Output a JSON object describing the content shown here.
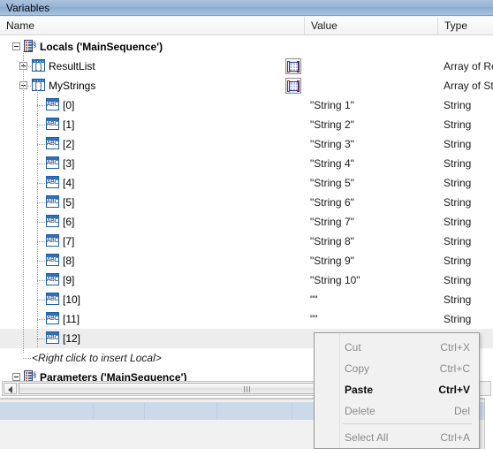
{
  "window": {
    "title": "Variables"
  },
  "columns": {
    "name": "Name",
    "value": "Value",
    "type": "Type"
  },
  "tree": {
    "root": {
      "label": "Locals ('MainSequence')",
      "icon": "locals-icon",
      "expander": "minus"
    },
    "nodes": [
      {
        "label": "ResultList",
        "icon": "array-icon",
        "expander": "plus",
        "value": "",
        "type": "Array of Result",
        "has_array_button": true
      },
      {
        "label": "MyStrings",
        "icon": "array-icon",
        "expander": "minus",
        "value": "",
        "type": "Array of String",
        "has_array_button": true
      },
      {
        "label": "[0]",
        "icon": "string-icon",
        "value": "\"String 1\"",
        "type": "String"
      },
      {
        "label": "[1]",
        "icon": "string-icon",
        "value": "\"String 2\"",
        "type": "String"
      },
      {
        "label": "[2]",
        "icon": "string-icon",
        "value": "\"String 3\"",
        "type": "String"
      },
      {
        "label": "[3]",
        "icon": "string-icon",
        "value": "\"String 4\"",
        "type": "String"
      },
      {
        "label": "[4]",
        "icon": "string-icon",
        "value": "\"String 5\"",
        "type": "String"
      },
      {
        "label": "[5]",
        "icon": "string-icon",
        "value": "\"String 6\"",
        "type": "String"
      },
      {
        "label": "[6]",
        "icon": "string-icon",
        "value": "\"String 7\"",
        "type": "String"
      },
      {
        "label": "[7]",
        "icon": "string-icon",
        "value": "\"String 8\"",
        "type": "String"
      },
      {
        "label": "[8]",
        "icon": "string-icon",
        "value": "\"String 9\"",
        "type": "String"
      },
      {
        "label": "[9]",
        "icon": "string-icon",
        "value": "\"String 10\"",
        "type": "String"
      },
      {
        "label": "[10]",
        "icon": "string-icon",
        "value": "\"\"",
        "type": "String"
      },
      {
        "label": "[11]",
        "icon": "string-icon",
        "value": "\"\"",
        "type": "String"
      },
      {
        "label": "[12]",
        "icon": "string-icon",
        "value": "",
        "type": "",
        "selected": true
      }
    ],
    "insert_hint": "<Right click to insert Local>",
    "next_section": {
      "label": "Parameters ('MainSequence')",
      "icon": "locals-icon",
      "expander": "minus"
    }
  },
  "context_menu": {
    "items": [
      {
        "label": "Cut",
        "accel": "Ctrl+X",
        "enabled": false
      },
      {
        "label": "Copy",
        "accel": "Ctrl+C",
        "enabled": false
      },
      {
        "label": "Paste",
        "accel": "Ctrl+V",
        "enabled": true
      },
      {
        "label": "Delete",
        "accel": "Del",
        "enabled": false
      },
      {
        "label": "Select All",
        "accel": "Ctrl+A",
        "enabled": false
      }
    ]
  },
  "icons": {
    "array_glyph": "[ ]",
    "string_glyph": "ABC",
    "locals_brace": "§"
  },
  "colors": {
    "titlebar": "#98b4d6",
    "selection": "#ededed",
    "icon_blue": "#2f6fb5",
    "strip_blue": "#cbd9e8"
  }
}
